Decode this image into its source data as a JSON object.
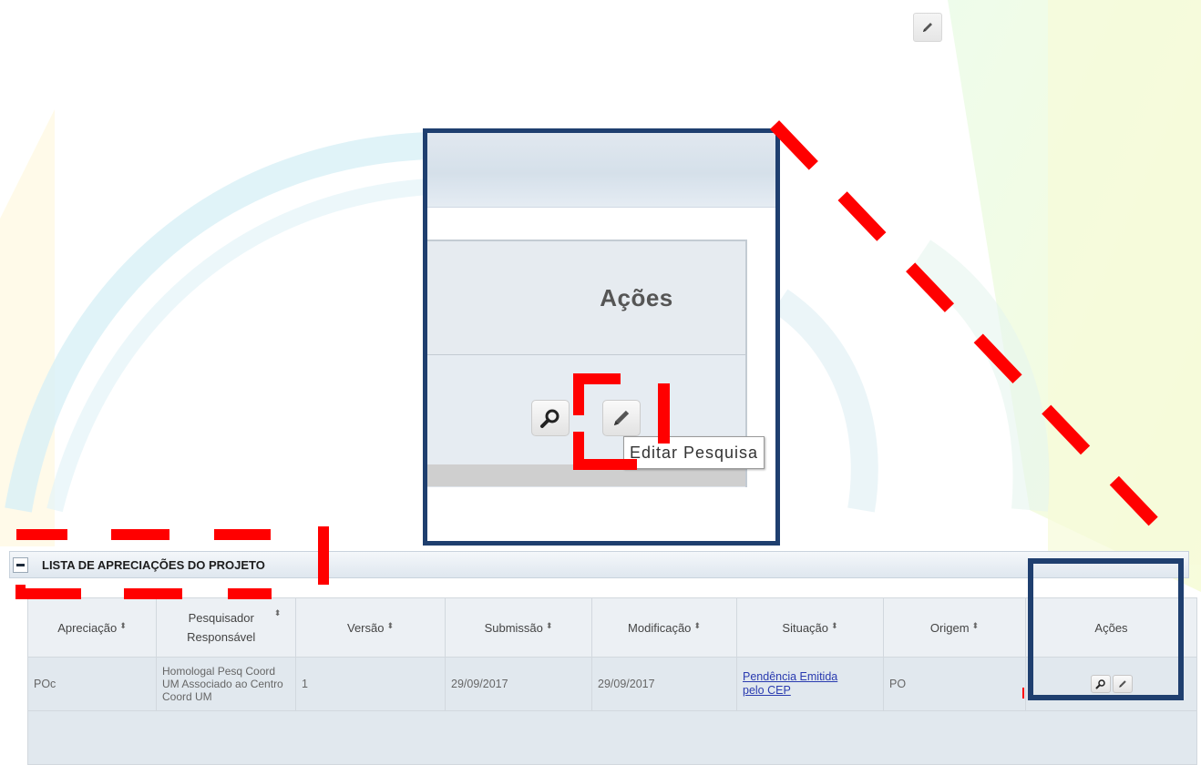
{
  "colors": {
    "highlight_red": "#ff0000",
    "highlight_blue": "#1f3f6f",
    "link": "#2a3bb0"
  },
  "zoom": {
    "header_label": "Ações",
    "tooltip": "Editar Pesquisa"
  },
  "panel": {
    "title": "LISTA DE APRECIAÇÕES DO PROJETO",
    "columns": [
      "Apreciação",
      "Pesquisador Responsável",
      "Versão",
      "Submissão",
      "Modificação",
      "Situação",
      "Origem",
      "Ações"
    ],
    "sort_indicator": "⬍",
    "rows": [
      {
        "apreciacao": "POc",
        "pesquisador": "Homologal Pesq Coord UM Associado ao Centro Coord UM",
        "versao": "1",
        "submissao": "29/09/2017",
        "modificacao": "29/09/2017",
        "situacao": "Pendência Emitida pelo CEP",
        "origem": "PO"
      }
    ]
  },
  "icons": [
    "pencil-icon",
    "magnifier-icon",
    "minus-icon"
  ]
}
